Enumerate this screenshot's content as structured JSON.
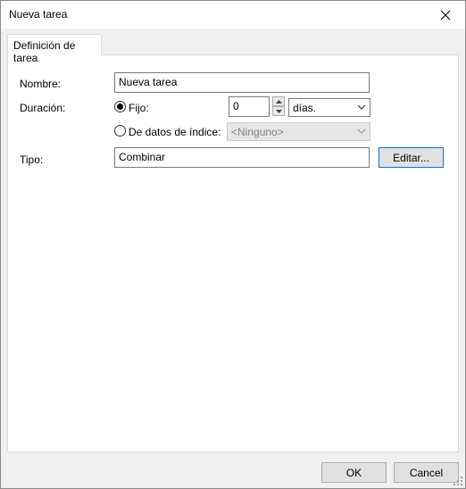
{
  "window": {
    "title": "Nueva tarea"
  },
  "tabs": [
    {
      "label": "Definición de tarea",
      "active": true
    }
  ],
  "form": {
    "name_label": "Nombre:",
    "name_value": "Nueva tarea",
    "duration_label": "Duración:",
    "fixed_label": "Fijo:",
    "fixed_selected": true,
    "fixed_value": "0",
    "unit_value": "días.",
    "index_label": "De datos de índice:",
    "index_selected": false,
    "index_value": "<Ninguno>",
    "type_label": "Tipo:",
    "type_value": "Combinar",
    "edit_button": "Editar..."
  },
  "footer": {
    "ok_label": "OK",
    "cancel_label": "Cancel"
  }
}
